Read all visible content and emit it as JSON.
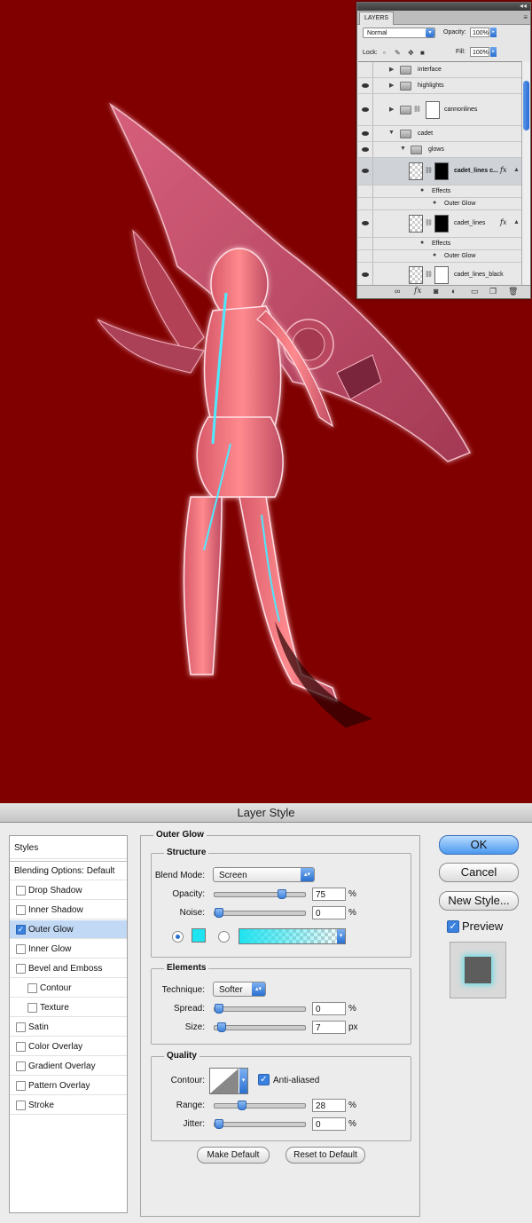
{
  "colors": {
    "canvas_background": "#800000",
    "glow_color": "#1ee3f0",
    "accent_blue": "#3b82e0"
  },
  "layers_panel": {
    "tab_label": "LAYERS",
    "blend_mode": "Normal",
    "opacity_label": "Opacity:",
    "opacity_value": "100%",
    "lock_label": "Lock:",
    "fill_label": "Fill:",
    "fill_value": "100%",
    "rows": [
      {
        "name": "interface",
        "type": "group",
        "visible": false,
        "expanded": false
      },
      {
        "name": "highlights",
        "type": "group",
        "visible": true,
        "expanded": false
      },
      {
        "name": "cannonlines",
        "type": "group-with-mask",
        "visible": true,
        "expanded": false
      },
      {
        "name": "cadet",
        "type": "group",
        "visible": true,
        "expanded": true
      },
      {
        "name": "glows",
        "type": "group",
        "visible": true,
        "expanded": true
      },
      {
        "name": "cadet_lines c...",
        "type": "layer",
        "visible": true,
        "fx": "fx",
        "selected": true
      },
      {
        "name": "Effects",
        "type": "effects-header"
      },
      {
        "name": "Outer Glow",
        "type": "effect"
      },
      {
        "name": "cadet_lines",
        "type": "layer",
        "visible": true,
        "fx": "fx"
      },
      {
        "name": "Effects",
        "type": "effects-header"
      },
      {
        "name": "Outer Glow",
        "type": "effect"
      },
      {
        "name": "cadet_lines_black",
        "type": "layer",
        "visible": true
      }
    ],
    "footer_icons": [
      "link-icon",
      "fx-icon",
      "mask-icon",
      "adjustment-icon",
      "folder-icon",
      "new-layer-icon",
      "trash-icon"
    ]
  },
  "layer_style": {
    "title": "Layer Style",
    "styles_header": "Styles",
    "blending_options": "Blending Options: Default",
    "effects": [
      {
        "label": "Drop Shadow",
        "checked": false,
        "indent": false
      },
      {
        "label": "Inner Shadow",
        "checked": false,
        "indent": false
      },
      {
        "label": "Outer Glow",
        "checked": true,
        "indent": false,
        "selected": true
      },
      {
        "label": "Inner Glow",
        "checked": false,
        "indent": false
      },
      {
        "label": "Bevel and Emboss",
        "checked": false,
        "indent": false
      },
      {
        "label": "Contour",
        "checked": false,
        "indent": true
      },
      {
        "label": "Texture",
        "checked": false,
        "indent": true
      },
      {
        "label": "Satin",
        "checked": false,
        "indent": false
      },
      {
        "label": "Color Overlay",
        "checked": false,
        "indent": false
      },
      {
        "label": "Gradient Overlay",
        "checked": false,
        "indent": false
      },
      {
        "label": "Pattern Overlay",
        "checked": false,
        "indent": false
      },
      {
        "label": "Stroke",
        "checked": false,
        "indent": false
      }
    ],
    "panel_title": "Outer Glow",
    "structure": {
      "title": "Structure",
      "blend_mode_label": "Blend Mode:",
      "blend_mode_value": "Screen",
      "opacity_label": "Opacity:",
      "opacity_value": "75",
      "opacity_fraction": 0.75,
      "noise_label": "Noise:",
      "noise_value": "0",
      "noise_fraction": 0,
      "percent": "%"
    },
    "elements": {
      "title": "Elements",
      "technique_label": "Technique:",
      "technique_value": "Softer",
      "spread_label": "Spread:",
      "spread_value": "0",
      "spread_fraction": 0,
      "size_label": "Size:",
      "size_value": "7",
      "size_unit": "px",
      "percent": "%"
    },
    "quality": {
      "title": "Quality",
      "contour_label": "Contour:",
      "anti_aliased_label": "Anti-aliased",
      "anti_aliased": true,
      "range_label": "Range:",
      "range_value": "28",
      "range_fraction": 0.28,
      "jitter_label": "Jitter:",
      "jitter_value": "0",
      "jitter_fraction": 0,
      "percent": "%"
    },
    "make_default": "Make Default",
    "reset_default": "Reset to Default",
    "buttons": {
      "ok": "OK",
      "cancel": "Cancel",
      "new_style": "New Style..."
    },
    "preview_label": "Preview",
    "preview_checked": true
  }
}
